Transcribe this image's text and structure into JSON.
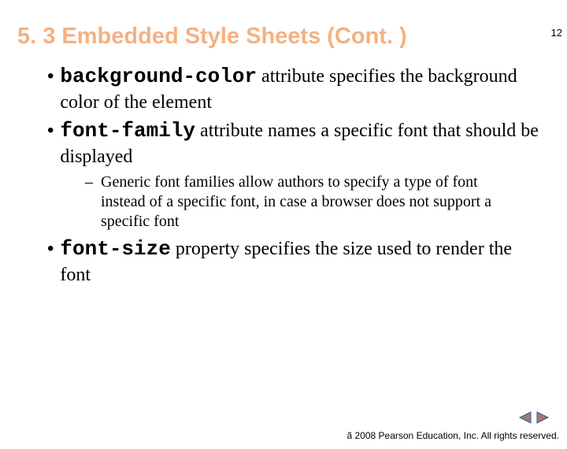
{
  "page_number": "12",
  "title": "5. 3 Embedded Style Sheets (Cont. )",
  "bullets": [
    {
      "code": "background-color",
      "rest": " attribute specifies the background color of the element"
    },
    {
      "code": "font-family",
      "rest": " attribute names a specific font that should be displayed",
      "sub": [
        "Generic font families allow authors to specify a type of font instead of a specific font, in case a browser does not support a specific font"
      ]
    },
    {
      "code": "font-size",
      "rest": " property specifies the size used to render the font"
    }
  ],
  "copyright_symbol": "ã",
  "copyright_text": " 2008 Pearson Education, Inc.  All rights reserved."
}
